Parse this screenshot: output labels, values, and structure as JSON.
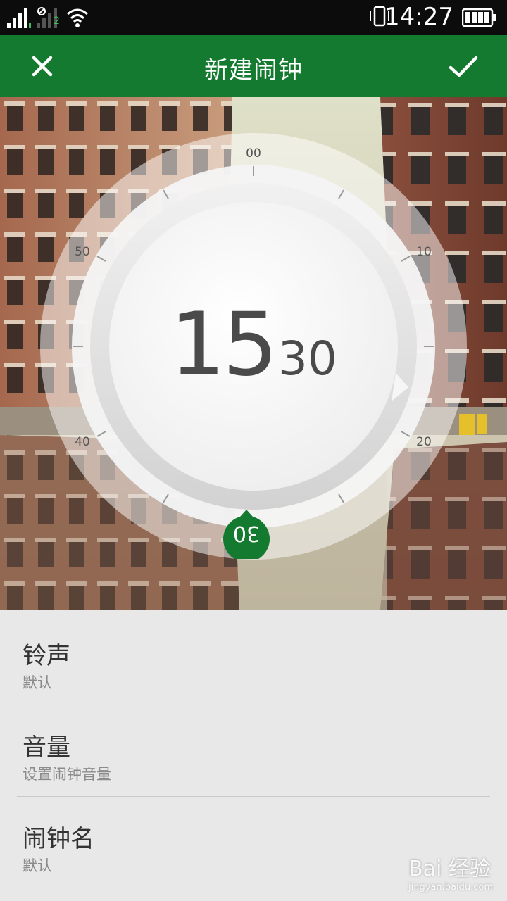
{
  "status_bar": {
    "time": "14:27",
    "sim2_label": "2",
    "icons": [
      "signal-icon",
      "signal-sim2-icon",
      "wifi-icon",
      "vibrate-icon",
      "battery-icon"
    ]
  },
  "app_bar": {
    "title": "新建闹钟",
    "close_icon": "close-icon",
    "confirm_icon": "check-icon",
    "accent": "#137a2f"
  },
  "dial": {
    "hour": "15",
    "minute": "30",
    "knob_value": "30",
    "minute_labels": {
      "m00": "00",
      "m10": "10",
      "m20": "20",
      "m40": "40",
      "m50": "50"
    }
  },
  "settings": {
    "ringtone": {
      "title": "铃声",
      "value": "默认"
    },
    "volume": {
      "title": "音量",
      "value": "设置闹钟音量"
    },
    "alarm_name": {
      "title": "闹钟名",
      "value": "默认"
    }
  },
  "watermark": {
    "text": "Bai 经验",
    "url": "jingyan.baidu.com"
  }
}
